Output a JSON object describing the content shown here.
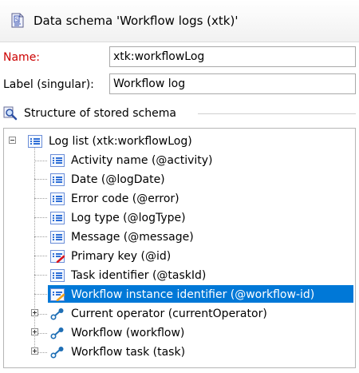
{
  "header": {
    "title": "Data schema 'Workflow logs (xtk)'",
    "icon": "schema-document-icon"
  },
  "form": {
    "name_label": "Name:",
    "name_value": "xtk:workflowLog",
    "label_label": "Label (singular):",
    "label_value": "Workflow log"
  },
  "structure": {
    "title": "Structure of stored schema",
    "icon": "magnifier-schema-icon"
  },
  "tree": {
    "root": {
      "label": "Log list (xtk:workflowLog)",
      "icon": "element-list-icon",
      "expanded": true
    },
    "attributes": [
      {
        "label": "Activity name (@activity)",
        "icon": "attribute-icon"
      },
      {
        "label": "Date (@logDate)",
        "icon": "attribute-icon"
      },
      {
        "label": "Error code (@error)",
        "icon": "attribute-icon"
      },
      {
        "label": "Log type (@logType)",
        "icon": "attribute-icon"
      },
      {
        "label": "Message (@message)",
        "icon": "attribute-icon"
      },
      {
        "label": "Primary key (@id)",
        "icon": "primary-key-attribute-icon"
      },
      {
        "label": "Task identifier (@taskId)",
        "icon": "attribute-icon"
      },
      {
        "label": "Workflow instance identifier (@workflow-id)",
        "icon": "foreign-key-attribute-icon",
        "selected": true
      }
    ],
    "links": [
      {
        "label": "Current operator (currentOperator)",
        "icon": "link-icon"
      },
      {
        "label": "Workflow (workflow)",
        "icon": "link-icon"
      },
      {
        "label": "Workflow task (task)",
        "icon": "link-icon"
      }
    ]
  },
  "colors": {
    "selection": "#0078d7",
    "required_label": "#cc0000",
    "link_icon": "#1f6fb5"
  }
}
